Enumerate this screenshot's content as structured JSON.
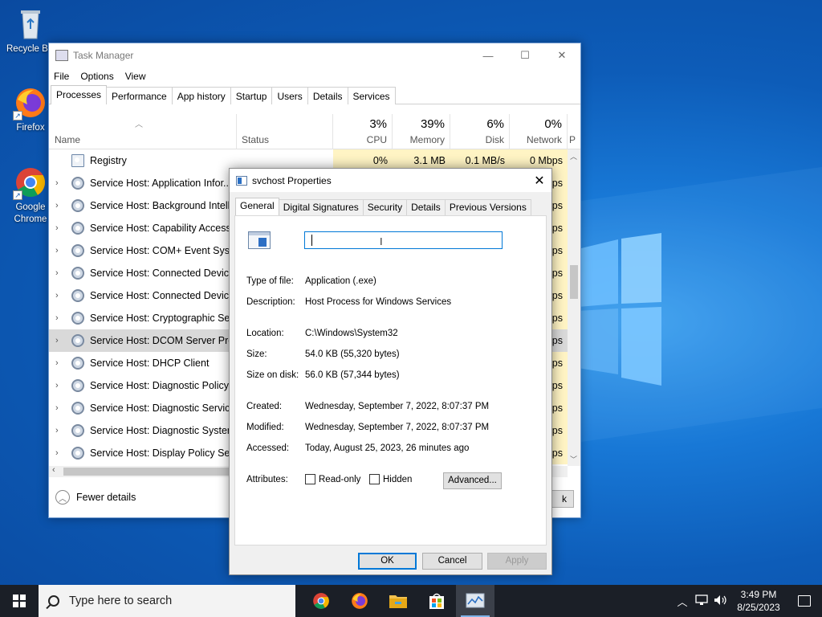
{
  "desktop": {
    "icons": [
      {
        "label": "Recycle Bin",
        "icon": "recycle-bin-icon"
      },
      {
        "label": "Firefox",
        "icon": "firefox-icon"
      },
      {
        "label": "Google Chrome",
        "icon": "chrome-icon"
      }
    ]
  },
  "task_manager": {
    "title": "Task Manager",
    "menu": [
      "File",
      "Options",
      "View"
    ],
    "tabs": [
      "Processes",
      "Performance",
      "App history",
      "Startup",
      "Users",
      "Details",
      "Services"
    ],
    "active_tab": "Processes",
    "columns": {
      "name": "Name",
      "status": "Status",
      "cpu": {
        "pct": "3%",
        "label": "CPU"
      },
      "memory": {
        "pct": "39%",
        "label": "Memory"
      },
      "disk": {
        "pct": "6%",
        "label": "Disk"
      },
      "network": {
        "pct": "0%",
        "label": "Network"
      },
      "power_partial": "P"
    },
    "rows": [
      {
        "name": "Registry",
        "cpu": "0%",
        "memory": "3.1 MB",
        "disk": "0.1 MB/s",
        "network": "0 Mbps",
        "expandable": false
      },
      {
        "name": "Service Host: Application Infor...",
        "network": "ps",
        "expandable": true
      },
      {
        "name": "Service Host: Background Intelli...",
        "network": "ps",
        "expandable": true
      },
      {
        "name": "Service Host: Capability Access ...",
        "network": "ps",
        "expandable": true
      },
      {
        "name": "Service Host: COM+ Event Syste...",
        "network": "ps",
        "expandable": true
      },
      {
        "name": "Service Host: Connected Device...",
        "network": "ps",
        "expandable": true
      },
      {
        "name": "Service Host: Connected Device...",
        "network": "ps",
        "expandable": true
      },
      {
        "name": "Service Host: Cryptographic Ser...",
        "network": "ps",
        "expandable": true
      },
      {
        "name": "Service Host: DCOM Server Proc...",
        "network": "ps",
        "expandable": true,
        "selected": true
      },
      {
        "name": "Service Host: DHCP Client",
        "network": "ps",
        "expandable": true
      },
      {
        "name": "Service Host: Diagnostic Policy ...",
        "network": "ps",
        "expandable": true
      },
      {
        "name": "Service Host: Diagnostic Service...",
        "network": "ps",
        "expandable": true
      },
      {
        "name": "Service Host: Diagnostic System...",
        "network": "ps",
        "expandable": true
      },
      {
        "name": "Service Host: Display Policy Serv...",
        "network": "ps",
        "expandable": true
      }
    ],
    "fewer_details": "Fewer details",
    "end_task_partial": "k"
  },
  "dialog": {
    "title": "svchost Properties",
    "tabs": [
      "General",
      "Digital Signatures",
      "Security",
      "Details",
      "Previous Versions"
    ],
    "active_tab": "General",
    "file_name_value": "",
    "fields": {
      "type_label": "Type of file:",
      "type_value": "Application (.exe)",
      "desc_label": "Description:",
      "desc_value": "Host Process for Windows Services",
      "loc_label": "Location:",
      "loc_value": "C:\\Windows\\System32",
      "size_label": "Size:",
      "size_value": "54.0 KB (55,320 bytes)",
      "disk_label": "Size on disk:",
      "disk_value": "56.0 KB (57,344 bytes)",
      "created_label": "Created:",
      "created_value": "Wednesday, September 7, 2022, 8:07:37 PM",
      "modified_label": "Modified:",
      "modified_value": "Wednesday, September 7, 2022, 8:07:37 PM",
      "accessed_label": "Accessed:",
      "accessed_value": "Today, August 25, 2023, 26 minutes ago",
      "attr_label": "Attributes:"
    },
    "readonly_label": "Read-only",
    "hidden_label": "Hidden",
    "advanced_label": "Advanced...",
    "ok_label": "OK",
    "cancel_label": "Cancel",
    "apply_label": "Apply"
  },
  "taskbar": {
    "search_placeholder": "Type here to search",
    "time": "3:49 PM",
    "date": "8/25/2023",
    "pinned": [
      "chrome-icon",
      "firefox-icon",
      "file-explorer-icon",
      "store-icon",
      "task-manager-icon"
    ]
  },
  "colors": {
    "desktop_blue": "#0d5cb8",
    "accent": "#0078d7",
    "heat_yellow": "#fff4c4",
    "taskbar": "#1b1f27"
  }
}
